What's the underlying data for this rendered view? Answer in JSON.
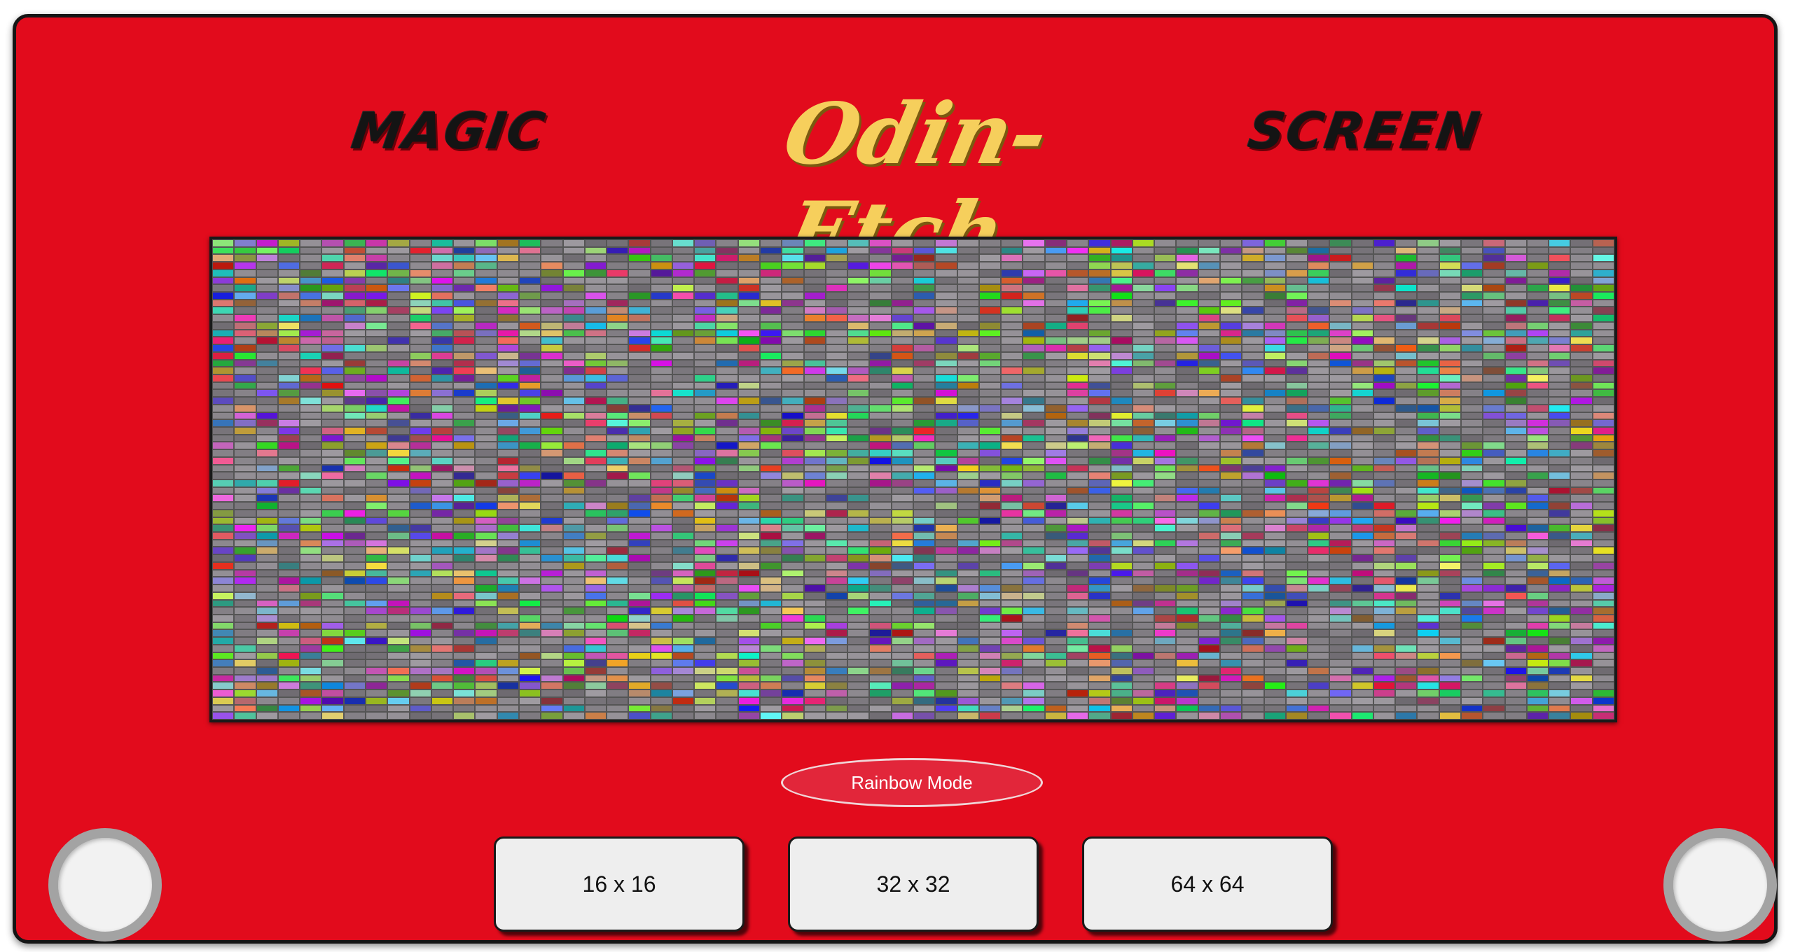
{
  "header": {
    "left_word": "MAGIC",
    "logo": "Odin-Etch",
    "right_word": "SCREEN"
  },
  "screen": {
    "grid_size": 64,
    "mode": "rainbow"
  },
  "controls": {
    "rainbow_label": "Rainbow Mode",
    "size_buttons": [
      "16 x 16",
      "32 x 32",
      "64 x 64"
    ]
  },
  "colors": {
    "frame": "#e20b1c",
    "logo": "#f6cf5c",
    "header_text": "#141414",
    "cell_base": "#777777",
    "button_bg": "#eeeeee",
    "rainbow_button": "#e2263a",
    "knob_ring": "#a3a3a3"
  },
  "icons": {
    "knob_left": "knob-icon",
    "knob_right": "knob-icon"
  }
}
